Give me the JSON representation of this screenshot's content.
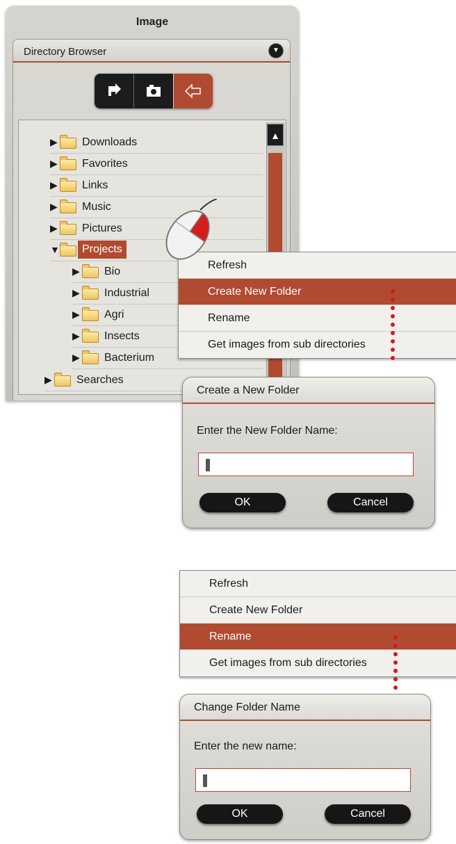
{
  "panel": {
    "title": "Image"
  },
  "directory_browser": {
    "title": "Directory Browser",
    "toolbar": {
      "icons": [
        "export-arrow-icon",
        "camera-icon",
        "back-arrow-icon"
      ]
    }
  },
  "tree": {
    "items": [
      {
        "label": "Downloads",
        "expanded": false,
        "selected": false
      },
      {
        "label": "Favorites",
        "expanded": false,
        "selected": false
      },
      {
        "label": "Links",
        "expanded": false,
        "selected": false
      },
      {
        "label": "Music",
        "expanded": false,
        "selected": false
      },
      {
        "label": "Pictures",
        "expanded": false,
        "selected": false
      },
      {
        "label": "Projects",
        "expanded": true,
        "selected": true
      },
      {
        "label": "Bio",
        "expanded": false,
        "selected": false
      },
      {
        "label": "Industrial",
        "expanded": false,
        "selected": false
      },
      {
        "label": "Agri",
        "expanded": false,
        "selected": false
      },
      {
        "label": "Insects",
        "expanded": false,
        "selected": false
      },
      {
        "label": "Bacterium",
        "expanded": false,
        "selected": false
      },
      {
        "label": "Searches",
        "expanded": false,
        "selected": false
      }
    ]
  },
  "context_menu_1": {
    "items": [
      "Refresh",
      "Create New Folder",
      "Rename",
      "Get images from sub directories"
    ],
    "active": "Create New Folder"
  },
  "dialog_new_folder": {
    "title": "Create a New Folder",
    "prompt": "Enter the New Folder Name:",
    "value": "",
    "ok": "OK",
    "cancel": "Cancel"
  },
  "context_menu_2": {
    "items": [
      "Refresh",
      "Create New Folder",
      "Rename",
      "Get images from sub directories"
    ],
    "active": "Rename"
  },
  "dialog_rename": {
    "title": "Change Folder Name",
    "prompt": "Enter the new name:",
    "value": "",
    "ok": "OK",
    "cancel": "Cancel"
  },
  "colors": {
    "accent": "#b04a30",
    "connector": "#d11a1a",
    "panel": "#c9c7c2",
    "button": "#161616"
  }
}
